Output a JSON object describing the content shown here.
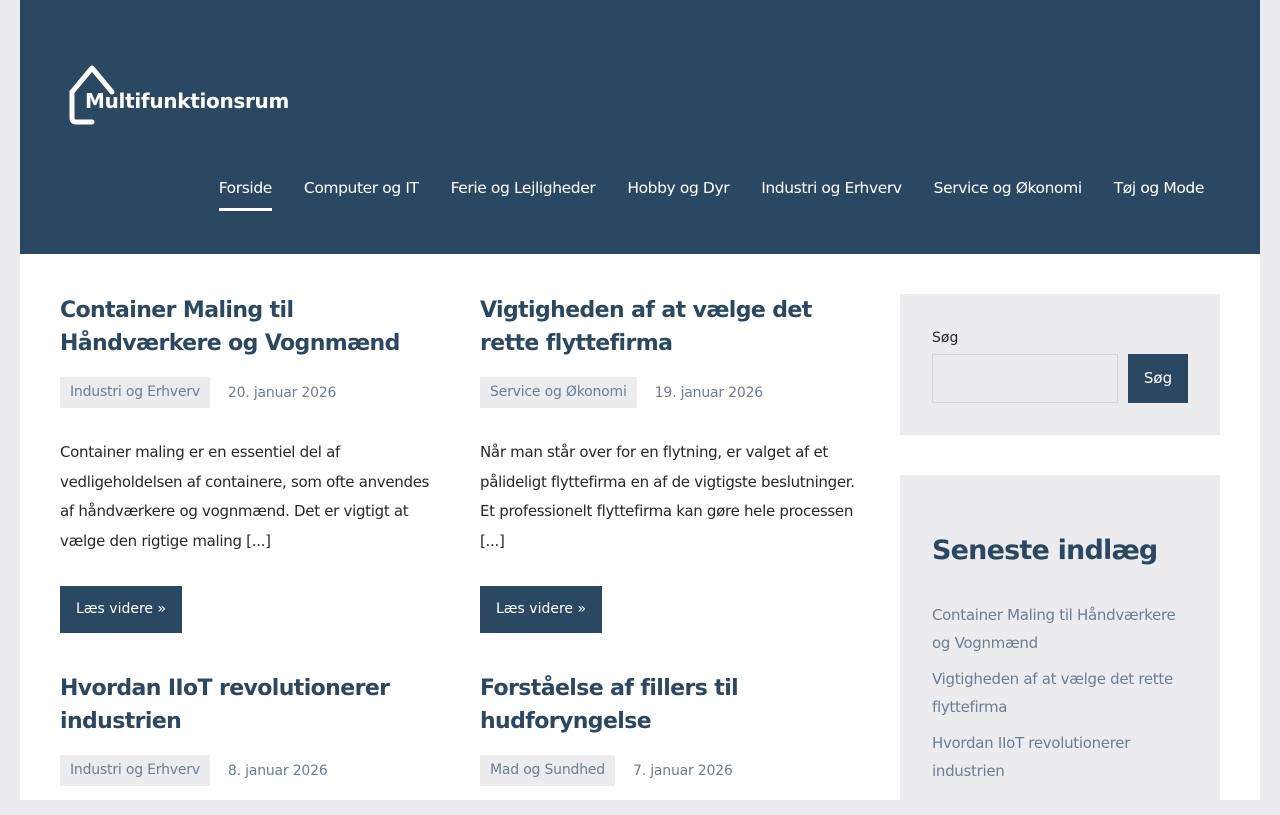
{
  "site": {
    "logo_text": "Multifunktionsrum"
  },
  "nav": {
    "items": [
      {
        "label": "Forside",
        "active": true
      },
      {
        "label": "Computer og IT"
      },
      {
        "label": "Ferie og Lejligheder"
      },
      {
        "label": "Hobby og Dyr"
      },
      {
        "label": "Industri og Erhverv"
      },
      {
        "label": "Service og Økonomi"
      },
      {
        "label": "Tøj og Mode"
      }
    ]
  },
  "posts": [
    {
      "title": "Container Maling til Håndværkere og Vognmænd",
      "category": "Industri og Erhverv",
      "date": "20. januar 2026",
      "excerpt": "Container maling er en essentiel del af vedligeholdelsen af containere, som ofte anvendes af håndværkere og vognmænd. Det er vigtigt at vælge den rigtige maling [...]",
      "read_more": "Læs videre »"
    },
    {
      "title": "Vigtigheden af at vælge det rette flyttefirma",
      "category": "Service og Økonomi",
      "date": "19. januar 2026",
      "excerpt": "Når man står over for en flytning, er valget af et pålideligt flyttefirma en af de vigtigste beslutninger. Et professionelt flyttefirma kan gøre hele processen [...]",
      "read_more": "Læs videre »"
    },
    {
      "title": "Hvordan IIoT revolutionerer industrien",
      "category": "Industri og Erhverv",
      "date": "8. januar 2026"
    },
    {
      "title": "Forståelse af fillers til hudforyngelse",
      "category": "Mad og Sundhed",
      "date": "7. januar 2026"
    }
  ],
  "sidebar": {
    "search": {
      "label": "Søg",
      "button": "Søg",
      "value": ""
    },
    "recent": {
      "title": "Seneste indlæg",
      "items": [
        "Container Maling til Håndværkere og Vognmænd",
        "Vigtigheden af at vælge det rette flyttefirma",
        "Hvordan IIoT revolutionerer industrien"
      ]
    }
  },
  "colors": {
    "header_bg": "#2b4863",
    "accent": "#2b4863",
    "meta_text": "#6a7f94",
    "widget_bg": "#ececee"
  }
}
